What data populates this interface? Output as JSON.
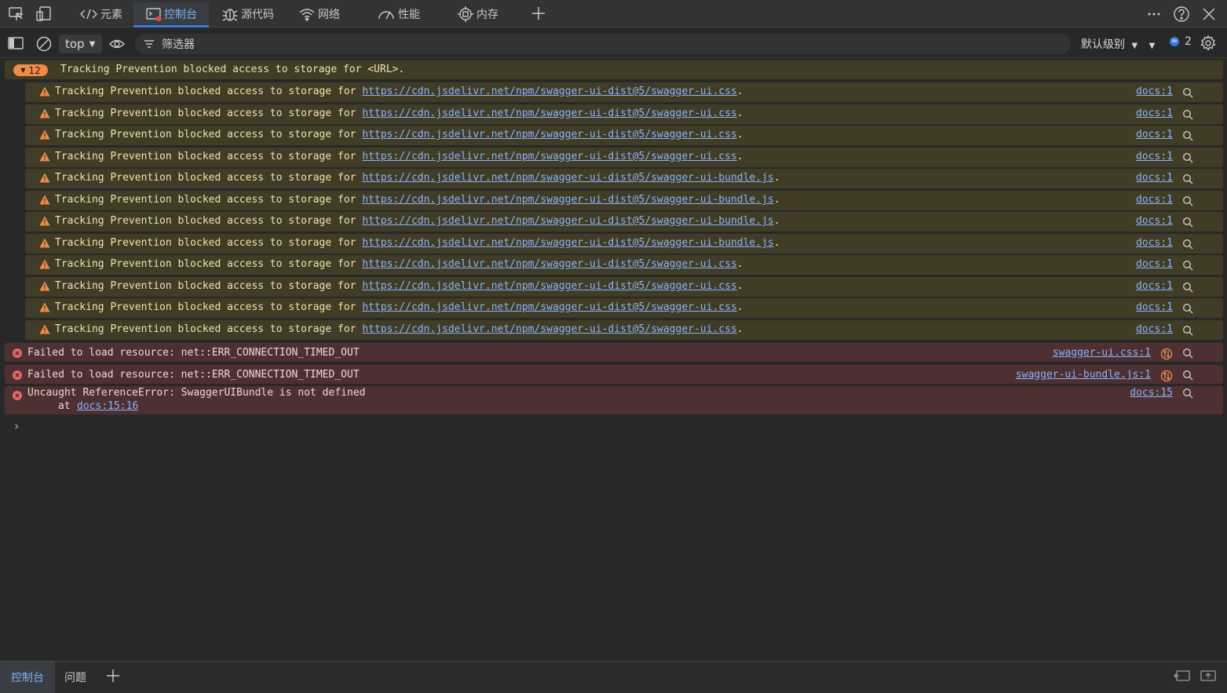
{
  "tabs": [
    {
      "label": "元素",
      "icon": "code-icon"
    },
    {
      "label": "控制台",
      "icon": "console-icon"
    },
    {
      "label": "源代码",
      "icon": "bug-icon"
    },
    {
      "label": "网络",
      "icon": "wifi-icon"
    },
    {
      "label": "性能",
      "icon": "gauge-icon"
    },
    {
      "label": "内存",
      "icon": "chip-icon"
    }
  ],
  "toolbar": {
    "context": "top",
    "filter_placeholder": "筛选器",
    "levels_label": "默认级别",
    "issues_count": "2"
  },
  "group": {
    "count": "12",
    "text": "Tracking Prevention blocked access to storage for <URL>."
  },
  "warning_prefix": "Tracking Prevention blocked access to storage for",
  "warnings": [
    {
      "url": "https://cdn.jsdelivr.net/npm/swagger-ui-dist@5/swagger-ui.css",
      "source": "docs:1"
    },
    {
      "url": "https://cdn.jsdelivr.net/npm/swagger-ui-dist@5/swagger-ui.css",
      "source": "docs:1"
    },
    {
      "url": "https://cdn.jsdelivr.net/npm/swagger-ui-dist@5/swagger-ui.css",
      "source": "docs:1"
    },
    {
      "url": "https://cdn.jsdelivr.net/npm/swagger-ui-dist@5/swagger-ui.css",
      "source": "docs:1"
    },
    {
      "url": "https://cdn.jsdelivr.net/npm/swagger-ui-dist@5/swagger-ui-bundle.js",
      "source": "docs:1"
    },
    {
      "url": "https://cdn.jsdelivr.net/npm/swagger-ui-dist@5/swagger-ui-bundle.js",
      "source": "docs:1"
    },
    {
      "url": "https://cdn.jsdelivr.net/npm/swagger-ui-dist@5/swagger-ui-bundle.js",
      "source": "docs:1"
    },
    {
      "url": "https://cdn.jsdelivr.net/npm/swagger-ui-dist@5/swagger-ui-bundle.js",
      "source": "docs:1"
    },
    {
      "url": "https://cdn.jsdelivr.net/npm/swagger-ui-dist@5/swagger-ui.css",
      "source": "docs:1"
    },
    {
      "url": "https://cdn.jsdelivr.net/npm/swagger-ui-dist@5/swagger-ui.css",
      "source": "docs:1"
    },
    {
      "url": "https://cdn.jsdelivr.net/npm/swagger-ui-dist@5/swagger-ui.css",
      "source": "docs:1"
    },
    {
      "url": "https://cdn.jsdelivr.net/npm/swagger-ui-dist@5/swagger-ui.css",
      "source": "docs:1"
    }
  ],
  "errors": [
    {
      "text": "Failed to load resource: net::ERR_CONNECTION_TIMED_OUT",
      "source": "swagger-ui.css:1"
    },
    {
      "text": "Failed to load resource: net::ERR_CONNECTION_TIMED_OUT",
      "source": "swagger-ui-bundle.js:1"
    },
    {
      "text": "Uncaught ReferenceError: SwaggerUIBundle is not defined",
      "trace_prefix": "at",
      "trace_link": "docs:15:16",
      "source": "docs:15"
    }
  ],
  "drawer": {
    "tabs": [
      "控制台",
      "问题"
    ]
  },
  "colors": {
    "warning_bg": "#413c26",
    "error_bg": "#4e3033",
    "link": "#8ab4f8",
    "accent": "#3a7ad7"
  }
}
